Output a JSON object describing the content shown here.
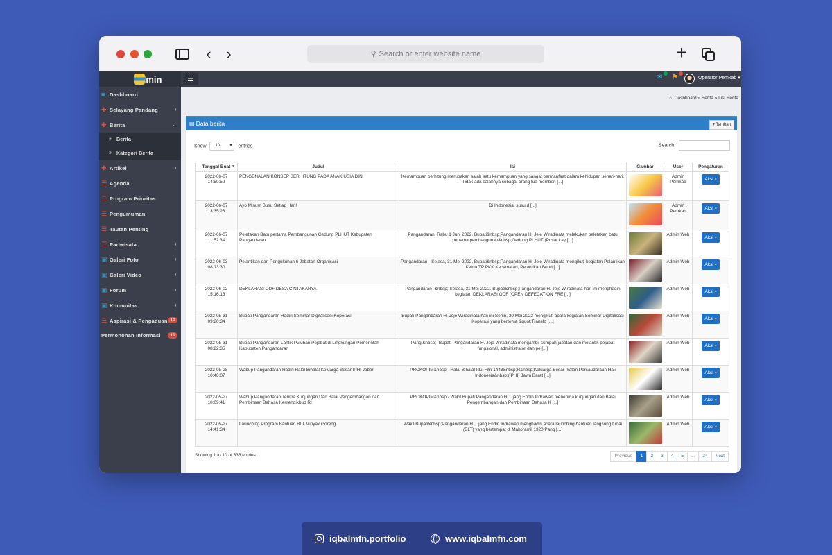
{
  "browser": {
    "address_placeholder": "Search or enter website name"
  },
  "sidebar": {
    "brand": "Admin",
    "items": [
      {
        "label": "Dashboard",
        "icon": "dashboard-icon",
        "chevron": false
      },
      {
        "label": "Selayang Pandang",
        "icon": "folder-icon",
        "chevron": true
      },
      {
        "label": "Berita",
        "icon": "folder-icon",
        "chevron": true,
        "expanded": true
      },
      {
        "label": "Artikel",
        "icon": "folder-icon",
        "chevron": true
      },
      {
        "label": "Agenda",
        "icon": "list-icon",
        "chevron": false
      },
      {
        "label": "Program Prioritas",
        "icon": "list-icon",
        "chevron": false
      },
      {
        "label": "Pengumuman",
        "icon": "list-icon",
        "chevron": false
      },
      {
        "label": "Tautan Penting",
        "icon": "list-icon",
        "chevron": false
      },
      {
        "label": "Pariwisata",
        "icon": "list-icon",
        "chevron": true
      },
      {
        "label": "Galeri Foto",
        "icon": "image-icon",
        "chevron": true
      },
      {
        "label": "Galeri Video",
        "icon": "image-icon",
        "chevron": true
      },
      {
        "label": "Forum",
        "icon": "image-icon",
        "chevron": true
      },
      {
        "label": "Komunitas",
        "icon": "image-icon",
        "chevron": true
      },
      {
        "label": "Aspirasi & Pengaduan",
        "icon": "list-icon",
        "badge": "10"
      },
      {
        "label": "Permohonan Informasi",
        "icon": "list-icon",
        "badge": "10"
      }
    ],
    "berita_sub": [
      "Berita",
      "Kategori Berita"
    ]
  },
  "topbar": {
    "user_name": "Operator Pemkab"
  },
  "breadcrumb": [
    "Dashboard",
    "Berita",
    "List Berita"
  ],
  "panel": {
    "title": "Data berita",
    "add_button": "Tambah",
    "show_label": "Show",
    "entries_value": "10",
    "entries_label": "entries",
    "search_label": "Search:"
  },
  "table": {
    "columns": [
      "Tanggal Buat",
      "Judul",
      "Isi",
      "Gambar",
      "User",
      "Pengaturan"
    ],
    "rows": [
      {
        "date": "2022-06-07",
        "time": "14:50:52",
        "judul": "PENGENALAN KONSEP BERHITUNG PADA ANAK USIA DINI",
        "isi": "Kemampuan berhitung merupakan salah satu kemampuan yang sangat bermanfaat dalam kehidupan sehari-hari. Tidak ada salahnya sebagai orang tua memberi [...]",
        "user": "Admin Pemkab",
        "action": "Aksi",
        "thumb_colors": [
          "#ffffff",
          "#f7c948",
          "#e85d75"
        ]
      },
      {
        "date": "2022-06-07",
        "time": "13:35:23",
        "judul": "Ayo Minum Susu Setiap Hari!",
        "isi": "Di Indonesia, susu d [...]",
        "user": "Admin Pemkab",
        "action": "Aksi",
        "thumb_colors": [
          "#bfe3f7",
          "#f28c38",
          "#e84a5f"
        ]
      },
      {
        "date": "2022-06-07",
        "time": "11:52:34",
        "judul": "Peletakan Batu pertama Pembangunan Gedung PLHUT Kabupaten Pangandaran",
        "isi": "Pangandaran, Rabu 1 Juni 2022. Bupati&nbsp;Pangandaran H. Jeje Wiradinata melakukan peletakan batu pertama pembangunan&nbsp;Gedung PLHUT (Pusat Lay [...]",
        "user": "Admin Web",
        "action": "Aksi",
        "thumb_colors": [
          "#6b7b3a",
          "#c9b27c",
          "#3a2f25"
        ]
      },
      {
        "date": "2022-06-03",
        "time": "08:13:30",
        "judul": "Pelantikan dan Pengukuhan 6 Jabatan Organisasi",
        "isi": "Pangandaran - Selasa, 31 Mei 2022. Bupati&nbsp;Pangandaran H. Jeje Wiradinata mengikuti kegiatan Pelantikan Ketua TP PKK Kecamatan, Pelantikan Bund [...]",
        "user": "Admin Web",
        "action": "Aksi",
        "thumb_colors": [
          "#7a1f2b",
          "#d8cfc4",
          "#2b2b2b"
        ]
      },
      {
        "date": "2022-06-02",
        "time": "15:16:13",
        "judul": "DEKLARASI ODF DESA CINTAKARYA",
        "isi": "Pangandaran -&nbsp; Selasa, 31 Mei 2022. Bupati&nbsp;Pangandaran H. Jeje Wiradinata hari ini menghadiri kegiatan DEKLARASI ODF (OPEN DEFECATION FRE [...]",
        "user": "Admin Web",
        "action": "Aksi",
        "thumb_colors": [
          "#4c7a3a",
          "#2f5d8a",
          "#e8e2d0"
        ]
      },
      {
        "date": "2022-05-31",
        "time": "09:20:34",
        "judul": "Bupati Pangandaran Hadiri Seminar Digitalisasi Koperasi",
        "isi": "Bupati Pangandaran H. Jeje Wiradinata hari ini Senin, 30 Mei 2022 mengikuti acara kegiatan Seminar Digitalisasi Koperasi yang bertema &quot;Transfo [...]",
        "user": "Admin Web",
        "action": "Aksi",
        "thumb_colors": [
          "#2a6a3a",
          "#b84a3a",
          "#d9d2c2"
        ]
      },
      {
        "date": "2022-05-31",
        "time": "08:22:35",
        "judul": "Bupati Pangandaran Lantik Puluhan Pejabat di Lingkungan Pemerintah Kabupaten Pangandaran",
        "isi": "Parigi&nbsp;- Bupati Pangandaran H. Jeje Wiradinata mengambil sumpah jabatan dan melantik pejabat fungsional, administrator dan pe [...]",
        "user": "Admin Web",
        "action": "Aksi",
        "thumb_colors": [
          "#8a1f1f",
          "#e0d6c6",
          "#3a3a3a"
        ]
      },
      {
        "date": "2022-05-28",
        "time": "10:40:07",
        "judul": "Wabup Pangandaran Hadiri Halal Bihalal Keluarga Besar IPHI Jabar",
        "isi": "PROKOPIM&nbsp;- Halal Bihalal Idul Fitri 1443&nbsp;H&nbsp;Keluarga Besar Ikatan Persaudaraan Haji Indonesia&nbsp;(IPHI) Jawa Barat [...]",
        "user": "Admin Web",
        "action": "Aksi",
        "thumb_colors": [
          "#e8c84a",
          "#ffffff",
          "#2b2b2b"
        ]
      },
      {
        "date": "2022-05-27",
        "time": "18:09:41",
        "judul": "Wabup Pangandaran Terima Kunjungan Dari Balai Pengembangan dan Pembinaan Bahasa Kemendikbud RI",
        "isi": "PROKOPIM&nbsp;- Wakil Bupati Pangandaran H. Ujang Endin Indrawan menerima kunjungan dari Balai Pengembangan dan Pembinaan Bahasa K [...]",
        "user": "Admin Web",
        "action": "Aksi",
        "thumb_colors": [
          "#3a3a2f",
          "#a8a08a",
          "#5a4a3a"
        ]
      },
      {
        "date": "2022-05-27",
        "time": "14:41:34",
        "judul": "Launching Program Bantuan BLT Minyak Goreng",
        "isi": "Wakil Bupati&nbsp;Pangandaran H. Ujang Endin Indrawan menghadiri acara launching bantuan langsung tunai (BLT) yang bertempat di Makoramil 1320 Pang [...]",
        "user": "Admin Web",
        "action": "Aksi",
        "thumb_colors": [
          "#3a6a3a",
          "#9ab86a",
          "#c43a3a"
        ]
      }
    ]
  },
  "footer": {
    "showing": "Showing 1 to 10 of 336 entries",
    "pages": [
      "Previous",
      "1",
      "2",
      "3",
      "4",
      "5",
      "...",
      "34",
      "Next"
    ],
    "active_page": "1"
  },
  "promo": {
    "instagram": "iqbalmfn.portfolio",
    "website": "www.iqbalmfn.com"
  }
}
